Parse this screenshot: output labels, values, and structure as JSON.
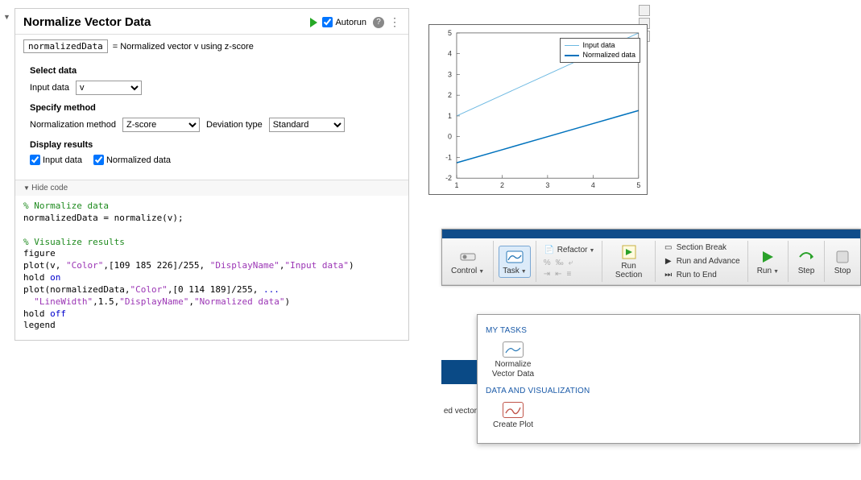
{
  "task": {
    "title": "Normalize Vector Data",
    "autorun_label": "Autorun",
    "output_var": "normalizedData",
    "output_desc": "= Normalized vector v using z-score",
    "select_data_label": "Select data",
    "input_data_label": "Input data",
    "input_data_value": "v",
    "specify_method_label": "Specify method",
    "norm_method_label": "Normalization method",
    "norm_method_value": "Z-score",
    "dev_type_label": "Deviation type",
    "dev_type_value": "Standard",
    "display_results_label": "Display results",
    "chk_input_label": "Input data",
    "chk_norm_label": "Normalized data",
    "hide_code_label": "Hide code"
  },
  "code": {
    "c1": "% Normalize data",
    "l1a": "normalizedData = normalize(v);",
    "c2": "% Visualize results",
    "l2": "figure",
    "l3_pre": "plot(v, ",
    "l3_s1": "\"Color\"",
    "l3_mid1": ",[109 185 226]/255, ",
    "l3_s2": "\"DisplayName\"",
    "l3_mid2": ",",
    "l3_s3": "\"Input data\"",
    "l3_end": ")",
    "l4a": "hold ",
    "l4b": "on",
    "l5_pre": "plot(normalizedData,",
    "l5_s1": "\"Color\"",
    "l5_mid1": ",[0 114 189]/255, ",
    "l5_cont": "...",
    "l6_sp": "  ",
    "l6_s1": "\"LineWidth\"",
    "l6_mid1": ",1.5,",
    "l6_s2": "\"DisplayName\"",
    "l6_mid2": ",",
    "l6_s3": "\"Normalized data\"",
    "l6_end": ")",
    "l7a": "hold ",
    "l7b": "off",
    "l8": "legend"
  },
  "chart_data": {
    "type": "line",
    "x": [
      1,
      2,
      3,
      4,
      5
    ],
    "series": [
      {
        "name": "Input data",
        "values": [
          1,
          2,
          3,
          4,
          5
        ],
        "color": "#6db9e2",
        "width": 1
      },
      {
        "name": "Normalized data",
        "values": [
          -1.26,
          -0.63,
          0,
          0.63,
          1.26
        ],
        "color": "#0072bd",
        "width": 1.5
      }
    ],
    "xlim": [
      1,
      5
    ],
    "ylim": [
      -2,
      5
    ],
    "xticks": [
      1,
      2,
      3,
      4,
      5
    ],
    "yticks": [
      -2,
      -1,
      0,
      1,
      2,
      3,
      4,
      5
    ],
    "legend": [
      "Input data",
      "Normalized data"
    ]
  },
  "toolstrip": {
    "control": "Control",
    "task": "Task",
    "refactor": "Refactor",
    "run_section": "Run Section",
    "section_break": "Section Break",
    "run_advance": "Run and Advance",
    "run_to_end": "Run to End",
    "run": "Run",
    "step": "Step",
    "stop": "Stop"
  },
  "gallery": {
    "my_tasks": "MY TASKS",
    "normalize": "Normalize Vector Data",
    "data_viz": "DATA AND VISUALIZATION",
    "create_plot": "Create Plot"
  },
  "snippet_text": "ed vector"
}
